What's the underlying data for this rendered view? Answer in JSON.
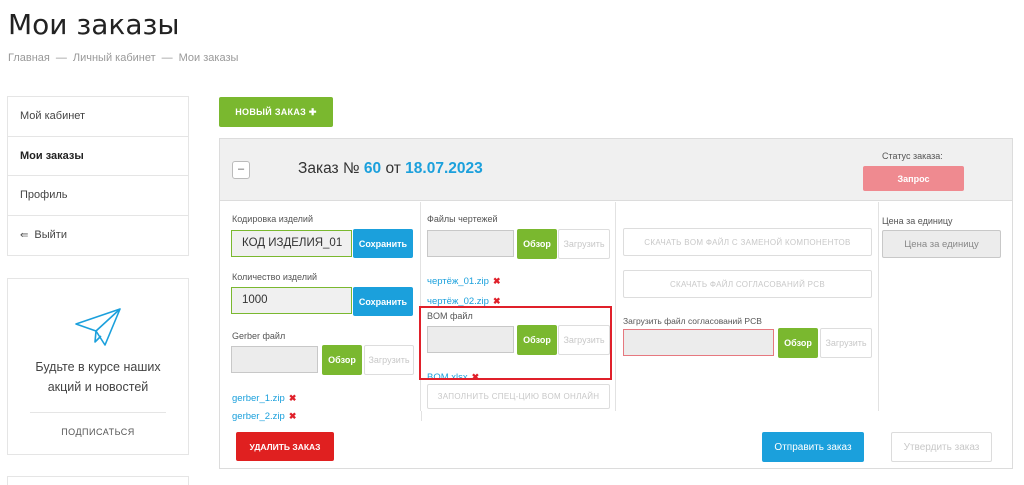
{
  "page": {
    "title": "Мои заказы",
    "breadcrumb": [
      "Главная",
      "Личный кабинет",
      "Мои заказы"
    ],
    "breadcrumb_sep": "—"
  },
  "sidebar": {
    "items": [
      {
        "label": "Мой кабинет"
      },
      {
        "label": "Мои заказы",
        "active": true
      },
      {
        "label": "Профиль"
      },
      {
        "label": "Выйти",
        "icon": "logout-icon"
      }
    ]
  },
  "subscribe": {
    "icon": "paper-plane-icon",
    "text_line1": "Будьте в курсе наших",
    "text_line2": "акций и новостей",
    "link": "ПОДПИСАТЬСЯ"
  },
  "toolbar": {
    "new_order": "НОВЫЙ ЗАКАЗ",
    "new_order_icon": "plus-icon",
    "new_order_plus": "✚"
  },
  "order": {
    "collapse": "–",
    "title_prefix": "Заказ №",
    "number": "60",
    "date_prefix": "от",
    "date": "18.07.2023",
    "status_label": "Статус заказа:",
    "status": "Запрос",
    "status_color": "#ef8a90"
  },
  "col1": {
    "code_label": "Кодировка изделий",
    "code_value": "КОД ИЗДЕЛИЯ_01",
    "save": "Сохранить",
    "qty_label": "Количество изделий",
    "qty_value": "1000",
    "gerber_label": "Gerber файл",
    "browse": "Обзор",
    "upload": "Загрузить",
    "files": [
      "gerber_1.zip",
      "gerber_2.zip"
    ],
    "remove": "✖"
  },
  "col2": {
    "drawings_label": "Файлы чертежей",
    "browse": "Обзор",
    "upload": "Загрузить",
    "drawing_files": [
      "чертёж_01.zip",
      "чертёж_02.zip"
    ],
    "bom_label": "BOM файл",
    "bom_files": [
      "BOM.xlsx"
    ],
    "fill_online": "ЗАПОЛНИТЬ СПЕЦ-ЦИЮ BOM ОНЛАЙН",
    "remove": "✖"
  },
  "col3": {
    "download_bom": "СКАЧАТЬ BOM ФАЙЛ С ЗАМЕНОЙ КОМПОНЕНТОВ",
    "download_pcb": "СКАЧАТЬ ФАЙЛ СОГЛАСОВАНИЙ PCB",
    "upload_pcb_label": "Загрузить файл согласований PCB",
    "browse": "Обзор",
    "upload": "Загрузить"
  },
  "col4": {
    "price_label": "Цена за единицу",
    "price_placeholder": "Цена за единицу"
  },
  "footer": {
    "delete": "УДАЛИТЬ ЗАКАЗ",
    "send": "Отправить заказ",
    "approve": "Утвердить заказ"
  },
  "colors": {
    "accent_green": "#7ab82f",
    "accent_blue": "#1ba0dc",
    "danger": "#e02020"
  }
}
